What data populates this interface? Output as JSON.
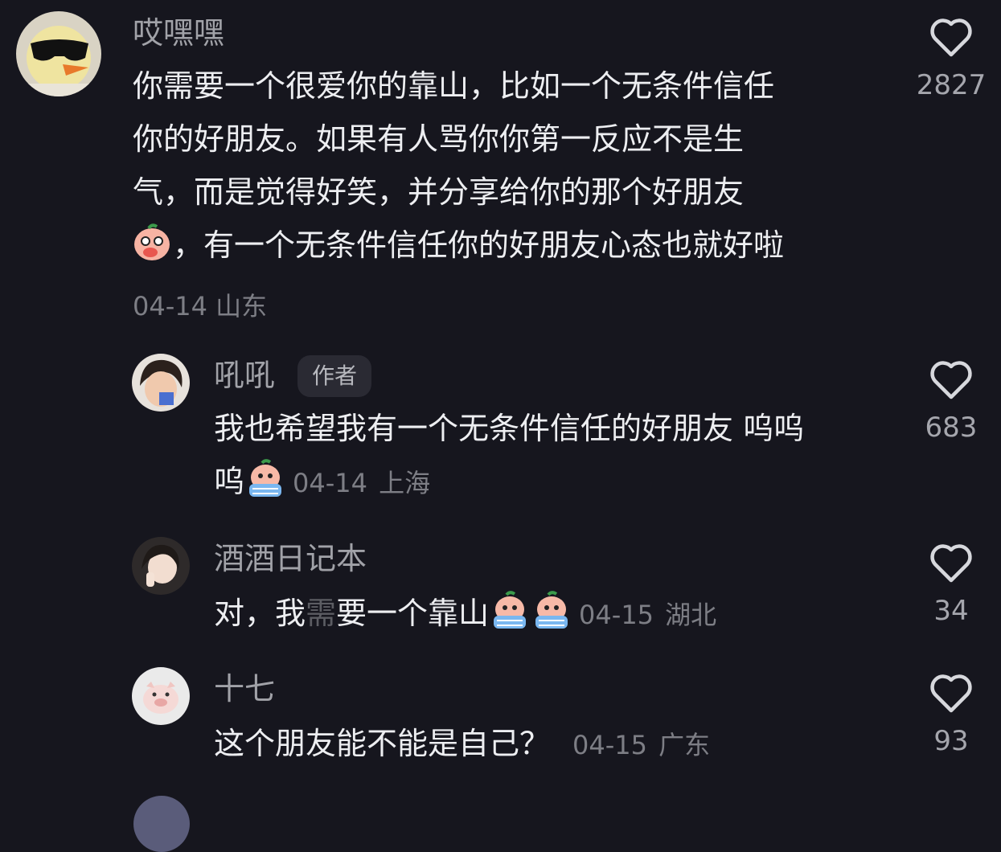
{
  "comments": [
    {
      "username": "哎嘿嘿",
      "text_lines": [
        "你需要一个很爱你的靠山，比如一个无条件信任",
        "你的好朋友。如果有人骂你你第一反应不是生",
        "气，而是觉得好笑，并分享给你的那个好朋友",
        "，有一个无条件信任你的好朋友心态也就好啦"
      ],
      "date": "04-14",
      "location": "山东",
      "likes": "2827",
      "avatar_icon": "duck-sunglasses-avatar",
      "emoji": "covering-mouth-emoji"
    },
    {
      "username": "吼吼",
      "badge": "作者",
      "text_line1": "我也希望我有一个无条件信任的好朋友 呜呜",
      "text_line2": "呜",
      "date": "04-14",
      "location": "上海",
      "likes": "683",
      "avatar_icon": "girl-avatar",
      "emoji": "crying-emoji"
    },
    {
      "username": "酒酒日记本",
      "text_a": "对，我",
      "text_b": "需",
      "text_c": "要一个靠山",
      "date": "04-15",
      "location": "湖北",
      "likes": "34",
      "avatar_icon": "girl-peace-sign-avatar",
      "emoji": "crying-emoji"
    },
    {
      "username": "十七",
      "text": "这个朋友能不能是自己？",
      "date": "04-15",
      "location": "广东",
      "likes": "93",
      "avatar_icon": "pig-toy-avatar"
    }
  ],
  "colors": {
    "background": "#16161e",
    "username": "#a1a2a8",
    "text": "#edeef1",
    "meta": "#7d7e85"
  }
}
